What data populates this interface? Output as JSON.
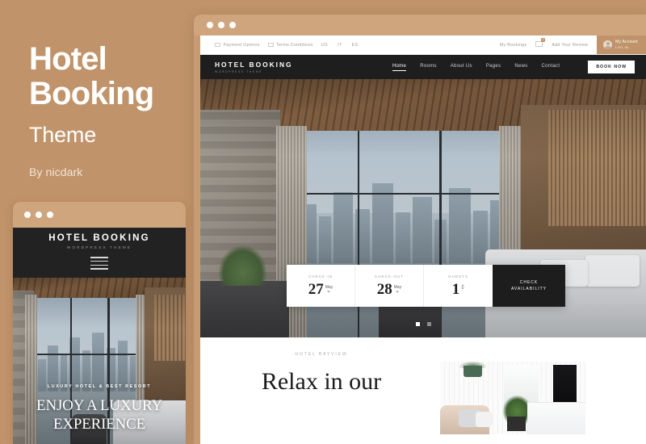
{
  "promo": {
    "title_line1": "Hotel",
    "title_line2": "Booking",
    "subtitle": "Theme",
    "byline": "By nicdark"
  },
  "theme": {
    "background_color": "#c0936a",
    "chrome_color": "#cfa57d",
    "accent_color": "#c0936a",
    "nav_bar_color": "#1e1e1e"
  },
  "desktop_mockup": {
    "utility_bar": {
      "left_items": [
        {
          "label": "Payment Options",
          "icon": "card-icon"
        },
        {
          "label": "Terms Conditions",
          "icon": "document-check-icon"
        }
      ],
      "languages": [
        "US",
        "IT",
        "ES"
      ],
      "right_items": [
        {
          "label": "My Bookings"
        },
        {
          "label": "Add Your Review"
        }
      ],
      "mail_badge_count": "2",
      "account": {
        "title": "My Account",
        "subtitle": "LOG IN"
      }
    },
    "navbar": {
      "logo_main": "HOTEL BOOKING",
      "logo_sub": "WORDPRESS THEME",
      "links": [
        {
          "label": "Home",
          "active": true
        },
        {
          "label": "Rooms",
          "active": false
        },
        {
          "label": "About Us",
          "active": false
        },
        {
          "label": "Pages",
          "active": false
        },
        {
          "label": "News",
          "active": false
        },
        {
          "label": "Contact",
          "active": false
        }
      ],
      "book_button": "BOOK NOW"
    },
    "booking_widget": {
      "checkin": {
        "label": "CHECK-IN",
        "day": "27",
        "month": "May"
      },
      "checkout": {
        "label": "CHECK-OUT",
        "day": "28",
        "month": "May"
      },
      "guests": {
        "label": "GUESTS",
        "value": "1"
      },
      "cta_line1": "CHECK",
      "cta_line2": "AVAILABILITY"
    },
    "slider": {
      "total_dots": 2,
      "active_index": 0
    },
    "content_section": {
      "kicker": "HOTEL BAYVIEW",
      "heading": "Relax in our"
    }
  },
  "mobile_mockup": {
    "logo_main": "HOTEL BOOKING",
    "logo_sub": "WORDPRESS THEME",
    "menu_icon": "hamburger-icon",
    "hero": {
      "kicker": "LUXURY HOTEL & BEST RESORT",
      "title_line1": "ENJOY A LUXURY",
      "title_line2": "EXPERIENCE"
    }
  }
}
